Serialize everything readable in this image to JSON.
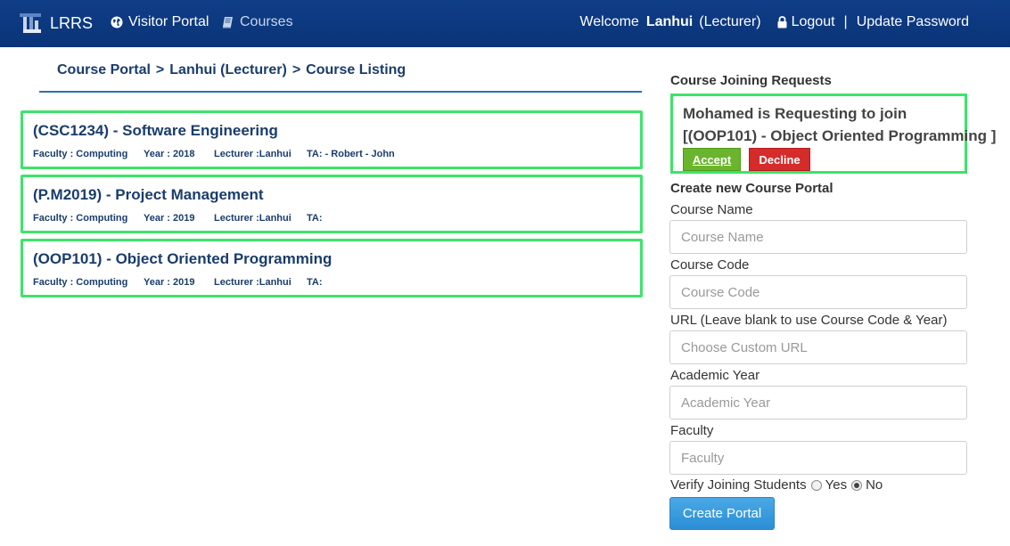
{
  "navbar": {
    "brand": "LRRS",
    "visitor_portal": "Visitor Portal",
    "courses": "Courses",
    "welcome": "Welcome",
    "user_name": "Lanhui",
    "user_role": "(Lecturer)",
    "logout": "Logout",
    "separator": "|",
    "update_password": "Update Password"
  },
  "breadcrumb": {
    "items": [
      "Course Portal",
      "Lanhui (Lecturer)",
      "Course Listing"
    ],
    "separator": ">"
  },
  "courses": [
    {
      "title": "(CSC1234) - Software Engineering",
      "faculty": "Faculty : Computing",
      "year": "Year : 2018",
      "lecturer": "Lecturer :Lanhui",
      "ta": "TA: - Robert - John"
    },
    {
      "title": "(P.M2019) - Project Management",
      "faculty": "Faculty : Computing",
      "year": "Year : 2019",
      "lecturer": "Lecturer :Lanhui",
      "ta": "TA:"
    },
    {
      "title": "(OOP101) - Object Oriented Programming",
      "faculty": "Faculty : Computing",
      "year": "Year : 2019",
      "lecturer": "Lecturer :Lanhui",
      "ta": "TA:"
    }
  ],
  "join_requests": {
    "heading": "Course Joining Requests",
    "items": [
      {
        "line1": "Mohamed is Requesting to join",
        "line2": "[(OOP101) - Object Oriented Programming ]",
        "accept": "Accept",
        "decline": "Decline"
      }
    ]
  },
  "create_portal": {
    "heading": "Create new Course Portal",
    "fields": [
      {
        "label": "Course Name",
        "placeholder": "Course Name",
        "value": ""
      },
      {
        "label": "Course Code",
        "placeholder": "Course Code",
        "value": ""
      },
      {
        "label": "URL (Leave blank to use Course Code & Year)",
        "placeholder": "Choose Custom URL",
        "value": ""
      },
      {
        "label": "Academic Year",
        "placeholder": "Academic Year",
        "value": ""
      },
      {
        "label": "Faculty",
        "placeholder": "Faculty",
        "value": ""
      }
    ],
    "verify_label": "Verify Joining Students",
    "verify_options": [
      "Yes",
      "No"
    ],
    "verify_selected": "No",
    "submit": "Create Portal"
  },
  "colors": {
    "navbar": "#0f3d87",
    "card_border": "#3ee36a",
    "accept": "#6ab52d",
    "decline": "#d62b2b",
    "primary": "#2b8ed6",
    "heading_text": "#1a3d6b"
  },
  "icons": {
    "brand": "lrrs-logo-icon",
    "visitor_portal": "globe-icon",
    "courses": "book-icon",
    "logout": "lock-icon"
  }
}
